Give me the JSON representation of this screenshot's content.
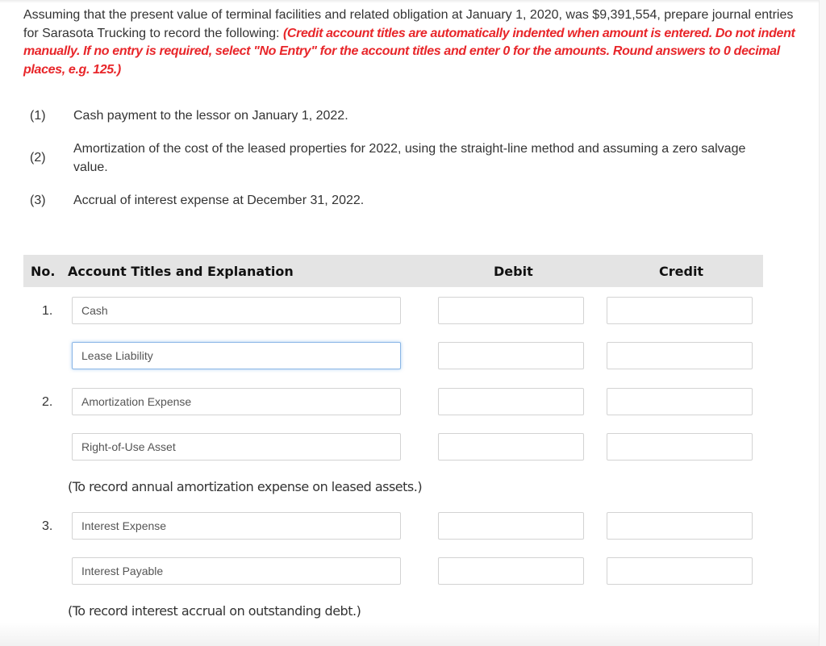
{
  "instructions": {
    "text": "Assuming that the present value of terminal facilities and related obligation at January 1, 2020, was $9,391,554, prepare journal entries for Sarasota Trucking to record the following: ",
    "note": "(Credit account titles are automatically indented when amount is entered. Do not indent manually. If no entry is required, select \"No Entry\" for the account titles and enter 0 for the amounts. Round answers to 0 decimal places, e.g. 125.)"
  },
  "requirements": [
    {
      "num": "(1)",
      "text": "Cash payment to the lessor on January 1, 2022."
    },
    {
      "num": "(2)",
      "text": "Amortization of the cost of the leased properties for 2022, using the straight-line method and assuming a zero salvage value."
    },
    {
      "num": "(3)",
      "text": "Accrual of interest expense at December 31, 2022."
    }
  ],
  "table": {
    "headers": {
      "no": "No.",
      "account": "Account Titles and Explanation",
      "debit": "Debit",
      "credit": "Credit"
    },
    "entries": [
      {
        "no": "1.",
        "lines": [
          {
            "account": "Cash",
            "debit": "",
            "credit": ""
          },
          {
            "account": "Lease Liability",
            "debit": "",
            "credit": "",
            "focused": true
          }
        ],
        "explanation": ""
      },
      {
        "no": "2.",
        "lines": [
          {
            "account": "Amortization Expense",
            "debit": "",
            "credit": ""
          },
          {
            "account": "Right-of-Use Asset",
            "debit": "",
            "credit": ""
          }
        ],
        "explanation": "(To record annual amortization expense on leased assets.)"
      },
      {
        "no": "3.",
        "lines": [
          {
            "account": "Interest Expense",
            "debit": "",
            "credit": ""
          },
          {
            "account": "Interest Payable",
            "debit": "",
            "credit": ""
          }
        ],
        "explanation": "(To record interest accrual on outstanding debt.)"
      }
    ]
  },
  "colors": {
    "instruction_red": "#e8262a",
    "header_bg": "#e4e4e4",
    "focus_border": "#8ab6e6"
  }
}
